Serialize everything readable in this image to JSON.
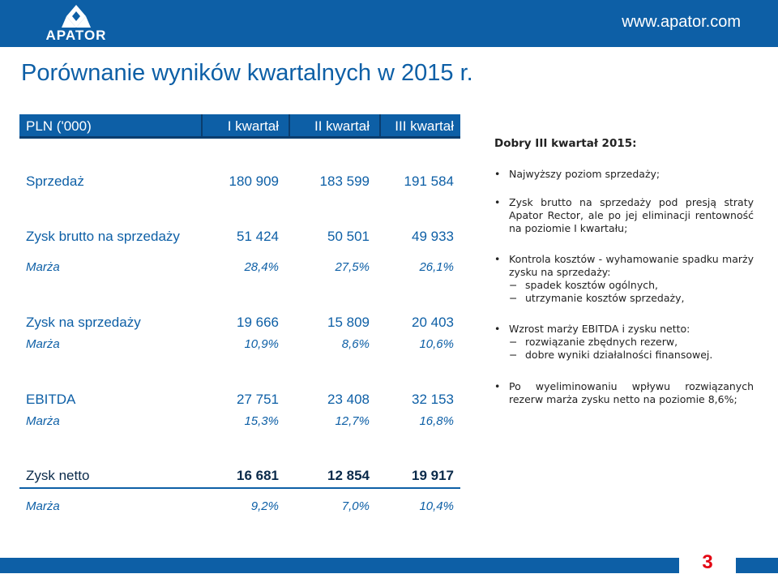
{
  "header": {
    "logo_text": "APATOR",
    "url": "www.apator.com"
  },
  "title": "Porównanie wyników kwartalnych w 2015 r.",
  "table": {
    "columns": [
      "PLN ('000)",
      "I kwartał",
      "II kwartał",
      "III kwartał"
    ],
    "rows": [
      {
        "label": "Sprzedaż",
        "values": [
          "180 909",
          "183 599",
          "191 584"
        ]
      },
      {
        "label": "Zysk brutto na sprzedaży",
        "values": [
          "51 424",
          "50 501",
          "49 933"
        ]
      },
      {
        "label": "Marża",
        "values": [
          "28,4%",
          "27,5%",
          "26,1%"
        ]
      },
      {
        "label": "Zysk na sprzedaży",
        "values": [
          "19 666",
          "15 809",
          "20 403"
        ]
      },
      {
        "label": "Marża",
        "values": [
          "10,9%",
          "8,6%",
          "10,6%"
        ]
      },
      {
        "label": "EBITDA",
        "values": [
          "27 751",
          "23 408",
          "32 153"
        ]
      },
      {
        "label": "Marża",
        "values": [
          "15,3%",
          "12,7%",
          "16,8%"
        ]
      },
      {
        "label": "Zysk netto",
        "values": [
          "16 681",
          "12 854",
          "19 917"
        ]
      },
      {
        "label": "Marża",
        "values": [
          "9,2%",
          "7,0%",
          "10,4%"
        ]
      }
    ]
  },
  "notes": {
    "heading": "Dobry III kwartał 2015:",
    "bullets": [
      {
        "text": "Najwyższy poziom sprzedaży;",
        "subs": []
      },
      {
        "text": "Zysk brutto na sprzedaży pod presją straty Apator Rector, ale po jej eliminacji rentowność na poziomie I kwartału;",
        "subs": []
      },
      {
        "text": "Kontrola kosztów - wyhamowanie spadku marży zysku na sprzedaży:",
        "subs": [
          "spadek kosztów ogólnych,",
          "utrzymanie kosztów sprzedaży,"
        ]
      },
      {
        "text": "Wzrost marży EBITDA i zysku netto:",
        "subs": [
          "rozwiązanie zbędnych rezerw,",
          "dobre wyniki działalności finansowej."
        ]
      },
      {
        "text": "Po wyeliminowaniu wpływu rozwiązanych rezerw marża zysku netto na poziomie 8,6%;",
        "subs": []
      }
    ],
    "bullet_symbol": "•",
    "dash_symbol": "−"
  },
  "page_number": "3",
  "colors": {
    "brand_blue": "#0d5fa6",
    "dark_blue": "#0a3d6e",
    "page_number_red": "#e30613"
  }
}
